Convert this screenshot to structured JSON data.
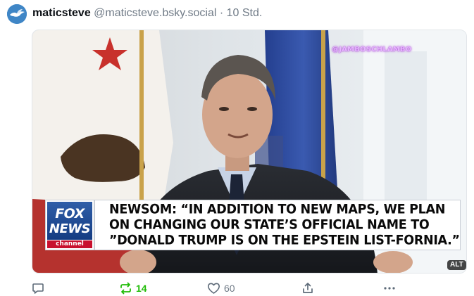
{
  "post": {
    "display_name": "maticsteve",
    "handle": "@maticsteve.bsky.social",
    "separator": "·",
    "time": "10 Std."
  },
  "media": {
    "watermark": "@JAMBOSCHLAMBO",
    "logo": {
      "word1": "FOX",
      "word2": "NEWS",
      "word3": "channel"
    },
    "chyron_lines": [
      "NEWSOM: “IN ADDITION TO NEW MAPS, WE PLAN",
      "ON CHANGING OUR STATE’S OFFICIAL NAME TO",
      "”DONALD TRUMP IS ON THE EPSTEIN LIST-FORNIA.”"
    ],
    "alt_badge": "ALT"
  },
  "actions": {
    "reply_count": "",
    "repost_count": "14",
    "like_count": "60"
  },
  "colors": {
    "repost_active": "#20bc07",
    "muted": "#6f7a86",
    "icon": "#5d6a78"
  },
  "icons": [
    "bird-avatar-icon",
    "reply-icon",
    "repost-icon",
    "like-icon",
    "share-icon",
    "more-icon"
  ]
}
